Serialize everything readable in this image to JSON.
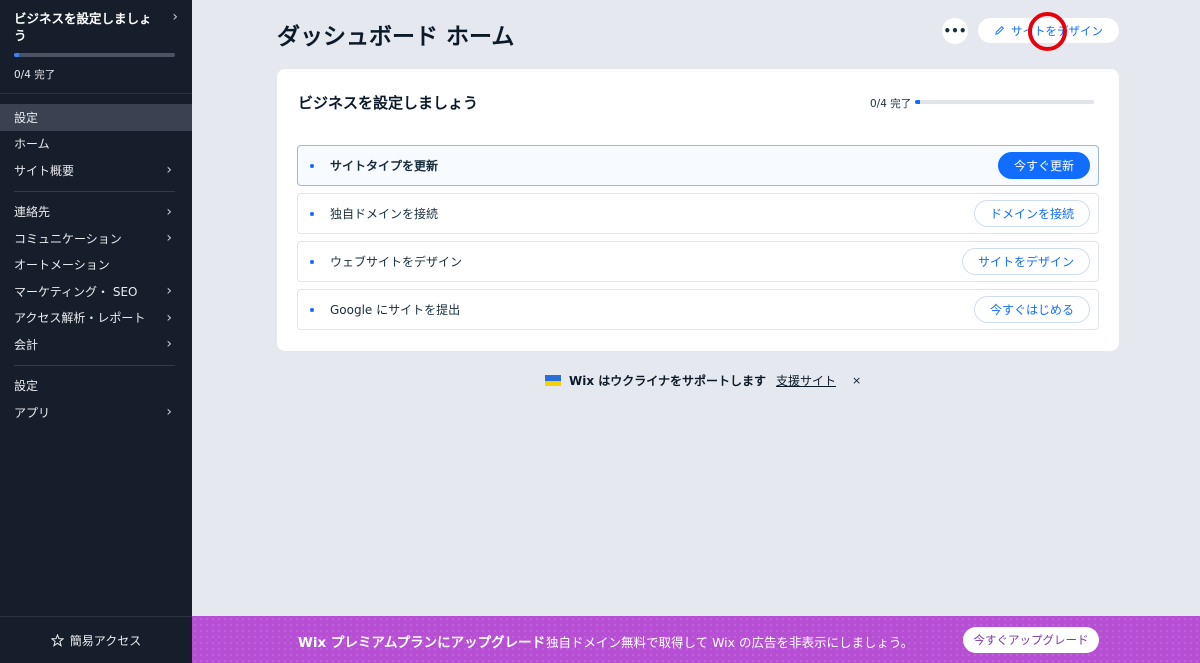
{
  "sidebar": {
    "setup": {
      "title": "ビジネスを設定しましょう",
      "progress_text": "0/4 完了",
      "progress_value": 0.03
    },
    "group1": [
      {
        "label": "設定",
        "active": true,
        "chevron": false
      },
      {
        "label": "ホーム",
        "active": false,
        "chevron": false
      },
      {
        "label": "サイト概要",
        "active": false,
        "chevron": true
      }
    ],
    "group2": [
      {
        "label": "連絡先",
        "chevron": true
      },
      {
        "label": "コミュニケーション",
        "chevron": true
      },
      {
        "label": "オートメーション",
        "chevron": false
      },
      {
        "label": "マーケティング・ SEO",
        "chevron": true
      },
      {
        "label": "アクセス解析・レポート",
        "chevron": true
      },
      {
        "label": "会計",
        "chevron": true
      }
    ],
    "group3": [
      {
        "label": "設定",
        "chevron": false
      },
      {
        "label": "アプリ",
        "chevron": true
      }
    ],
    "footer_label": "簡易アクセス"
  },
  "header": {
    "title": "ダッシュボード ホーム",
    "more_label": "•••",
    "design_label": "サイトをデザイン"
  },
  "setup_card": {
    "title": "ビジネスを設定しましょう",
    "progress_text": "0/4 完了",
    "progress_value": 0.03,
    "tasks": [
      {
        "label": "サイトタイプを更新",
        "button": "今すぐ更新",
        "primary": true
      },
      {
        "label": "独自ドメインを接続",
        "button": "ドメインを接続",
        "primary": false
      },
      {
        "label": "ウェブサイトをデザイン",
        "button": "サイトをデザイン",
        "primary": false
      },
      {
        "label": "Google にサイトを提出",
        "button": "今すぐはじめる",
        "primary": false
      }
    ]
  },
  "notice": {
    "text": "Wix はウクライナをサポートします",
    "link": "支援サイト",
    "close": "×"
  },
  "banner": {
    "title": "Wix プレミアムプランにアップグレード",
    "subtitle": "独自ドメイン無料で取得して Wix の広告を非表示にしましょう。",
    "button": "今すぐアップグレード"
  },
  "colors": {
    "accent": "#116dff",
    "sidebar_bg": "#161d2b",
    "banner_bg": "#b64fd3",
    "highlight": "#e8000b"
  }
}
